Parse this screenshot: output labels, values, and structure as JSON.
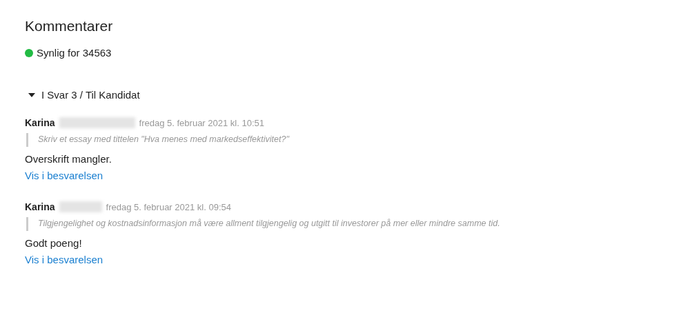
{
  "title": "Kommentarer",
  "visibility": {
    "label": "Synlig for 34563",
    "color": "#22bb44"
  },
  "section": {
    "label": "I Svar 3 / Til Kandidat",
    "expanded": true,
    "comments": [
      {
        "author": "Karina",
        "date": "fredag 5. februar 2021 kl. 10:51",
        "quote": "Skriv et essay med tittelen \"Hva menes med markedseffektivitet?\"",
        "text": "Overskrift mangler.",
        "link": "Vis i besvarelsen"
      },
      {
        "author": "Karina",
        "date": "fredag 5. februar 2021 kl. 09:54",
        "quote": "Tilgjengelighet og kostnadsinformasjon må være allment tilgjengelig og utgitt til investorer på mer eller mindre samme tid.",
        "text": "Godt poeng!",
        "link": "Vis i besvarelsen"
      }
    ]
  }
}
